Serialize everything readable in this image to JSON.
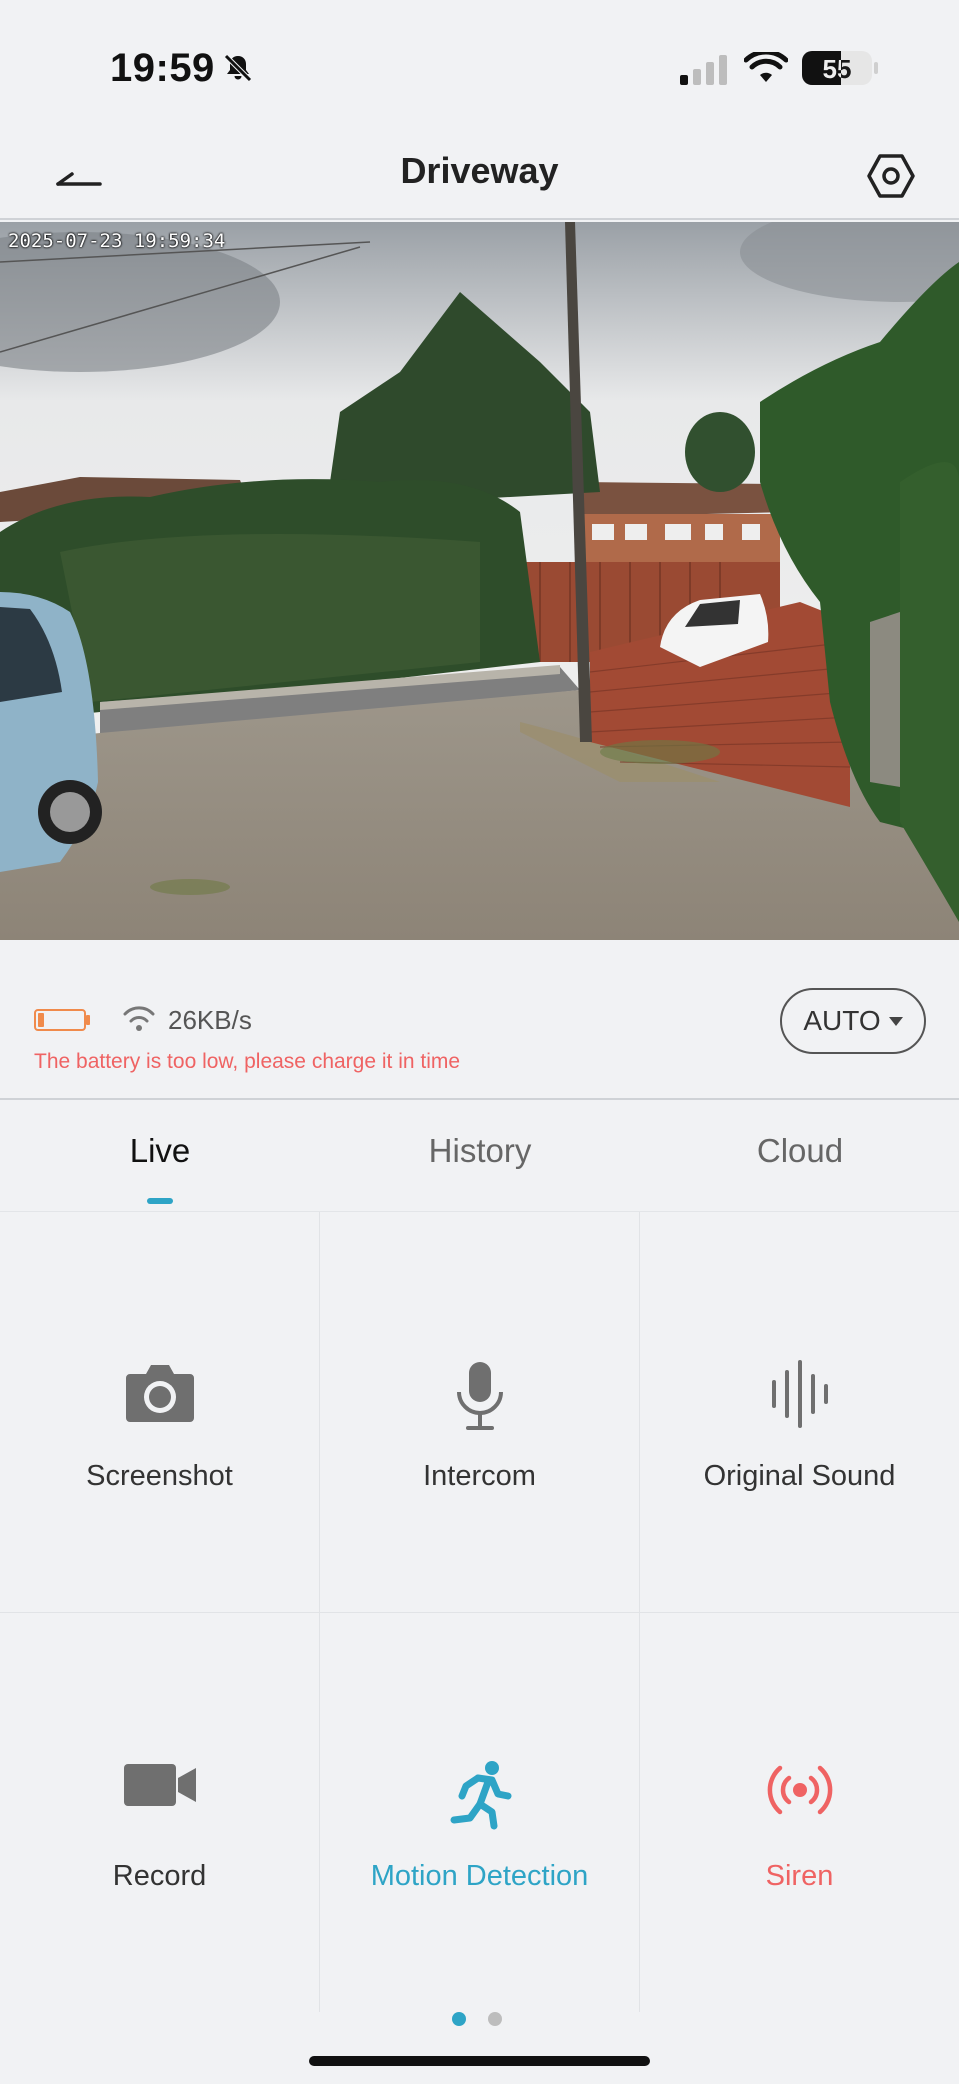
{
  "status_bar": {
    "time": "19:59",
    "battery_level": "55"
  },
  "nav": {
    "title": "Driveway"
  },
  "video": {
    "timestamp": "2025-07-23 19:59:34"
  },
  "info": {
    "net_speed": "26KB/s",
    "low_battery_msg": "The battery is too low, please charge it in time",
    "quality": "AUTO"
  },
  "tabs": [
    {
      "label": "Live",
      "active": true
    },
    {
      "label": "History"
    },
    {
      "label": "Cloud"
    }
  ],
  "controls": [
    {
      "label": "Screenshot",
      "icon": "camera-icon"
    },
    {
      "label": "Intercom",
      "icon": "microphone-icon"
    },
    {
      "label": "Original Sound",
      "icon": "sound-wave-icon"
    },
    {
      "label": "Record",
      "icon": "video-camera-icon"
    },
    {
      "label": "Motion Detection",
      "icon": "running-person-icon"
    },
    {
      "label": "Siren",
      "icon": "siren-icon"
    }
  ],
  "colors": {
    "accent": "#2ea4c6",
    "warning": "#ef6363",
    "battery_low": "#f08a4b"
  }
}
